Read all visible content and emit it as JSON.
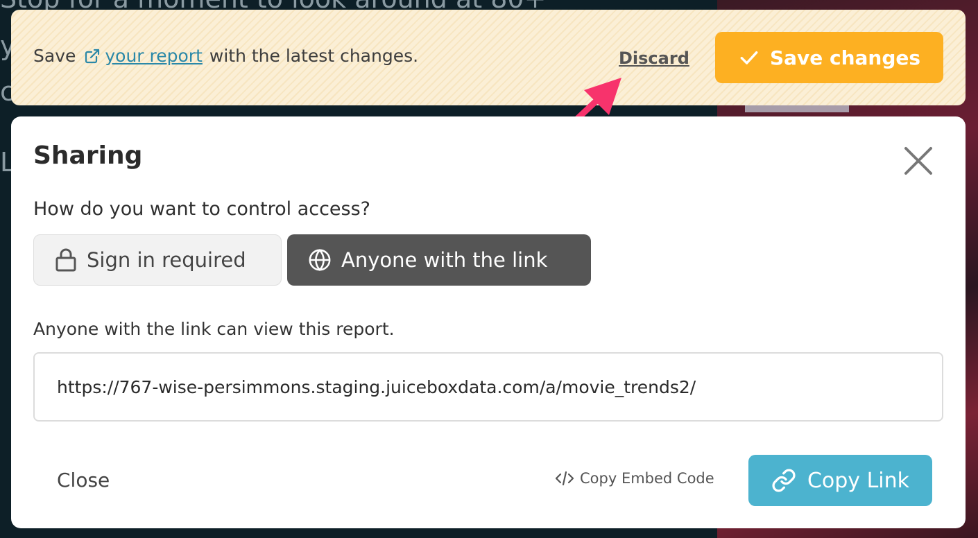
{
  "background": {
    "lines": [
      "Stop for a moment to look around at 80+",
      "y",
      "c",
      "L"
    ]
  },
  "banner": {
    "prefix": "Save",
    "link_text": "your report",
    "suffix": "with the latest changes.",
    "discard_label": "Discard",
    "save_label": "Save changes",
    "colors": {
      "background": "#fbefd6",
      "save_button": "#fdb022",
      "link": "#2a88a8"
    }
  },
  "annotation": {
    "arrow_color": "#f7336c",
    "icon": "pointer-arrow"
  },
  "modal": {
    "title": "Sharing",
    "question": "How do you want to control access?",
    "access_options": [
      {
        "label": "Sign in required",
        "icon": "lock-icon",
        "selected": false
      },
      {
        "label": "Anyone with the link",
        "icon": "globe-icon",
        "selected": true
      }
    ],
    "access_note": "Anyone with the link can view this report.",
    "share_url": "https://767-wise-persimmons.staging.juiceboxdata.com/a/movie_trends2/",
    "footer": {
      "close_label": "Close",
      "embed_label": "Copy Embed Code",
      "copy_link_label": "Copy Link"
    },
    "colors": {
      "selected_option": "#555555",
      "copy_button": "#4cb3cf"
    }
  }
}
